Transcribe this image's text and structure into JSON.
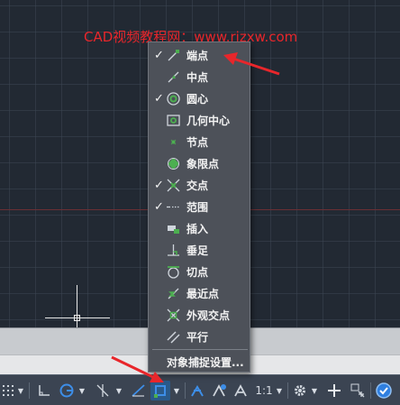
{
  "watermark": "CAD视频教程网：www.rjzxw.com",
  "menu": {
    "items": [
      {
        "label": "端点",
        "checked": true,
        "icon": "endpoint-icon"
      },
      {
        "label": "中点",
        "checked": false,
        "icon": "midpoint-icon"
      },
      {
        "label": "圆心",
        "checked": true,
        "icon": "center-icon"
      },
      {
        "label": "几何中心",
        "checked": false,
        "icon": "geometric-center-icon"
      },
      {
        "label": "节点",
        "checked": false,
        "icon": "node-icon"
      },
      {
        "label": "象限点",
        "checked": false,
        "icon": "quadrant-icon"
      },
      {
        "label": "交点",
        "checked": true,
        "icon": "intersection-icon"
      },
      {
        "label": "范围",
        "checked": true,
        "icon": "extension-icon"
      },
      {
        "label": "插入",
        "checked": false,
        "icon": "insert-icon"
      },
      {
        "label": "垂足",
        "checked": false,
        "icon": "perpendicular-icon"
      },
      {
        "label": "切点",
        "checked": false,
        "icon": "tangent-icon"
      },
      {
        "label": "最近点",
        "checked": false,
        "icon": "nearest-icon"
      },
      {
        "label": "外观交点",
        "checked": false,
        "icon": "apparent-intersection-icon"
      },
      {
        "label": "平行",
        "checked": false,
        "icon": "parallel-icon"
      }
    ],
    "settings_label": "对象捕捉设置..."
  },
  "statusbar": {
    "scale": "1:1",
    "check_mark": "✓"
  },
  "colors": {
    "annotation_red": "#e8262b",
    "canvas": "#222933",
    "menu_bg": "#4d5159"
  }
}
